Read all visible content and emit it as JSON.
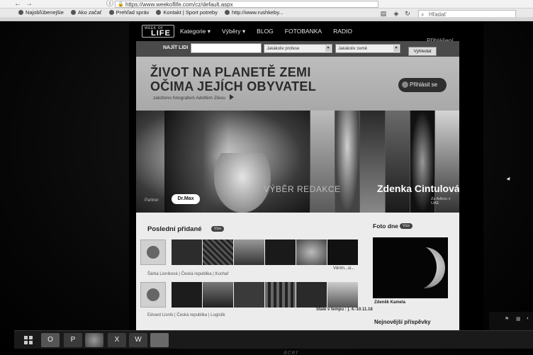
{
  "browser": {
    "url": "https://www.weekoflife.com/cz/default.aspx",
    "search_placeholder": "Hľadať",
    "bookmarks": [
      "Najobľúbenejšie",
      "Ako začať",
      "Prehľad správ",
      "Kontakt | Sport potreby",
      "http://www.rushkeby..."
    ]
  },
  "site": {
    "logo_small": "WEEK OF",
    "logo_big": "LIFE",
    "menu": [
      "Kategorie",
      "Výběry",
      "BLOG",
      "FOTOBANKA",
      "RADIO"
    ],
    "menu_dropdown_marks": [
      "▾",
      "▾",
      "",
      "",
      ""
    ],
    "login_link": "Přihlášení",
    "search": {
      "label": "NAJÍT LIDI",
      "profession": "Jakákoliv profese",
      "country": "Jakákoliv země",
      "button": "Vyhledat"
    },
    "hero": {
      "headline_1": "ŽIVOT NA PLANETĚ ZEMI",
      "headline_2": "OČIMA JEJÍCH OBYVATEL",
      "subline": "založeno fotografem Adolfem Zikou",
      "signin": "Přihlásit se"
    },
    "feature": {
      "partner_label": "Partner",
      "partner": "Dr.Max",
      "section": "VÝBĚR REDAKCE",
      "name": "Zdenka Cintulová",
      "sub": "Za Adkou v UAE"
    },
    "latest": {
      "title": "Poslední přidané",
      "more": "Více",
      "rows": [
        {
          "meta": "Šárka Lisníková  |  Česká republika  |  Kuchař",
          "right": "Věrím...si..."
        },
        {
          "meta": "Edvard Lisník  |  Česká republika  |  Logistik",
          "right": "Stále v tempu : ). 4.-10.11.18"
        }
      ]
    },
    "photo_of_day": {
      "title": "Foto dne",
      "more": "Více",
      "author": "Zdeněk Kamela"
    },
    "next_section": "Nejnovější příspěvky"
  },
  "taskbar": {
    "icons": [
      "windows-start",
      "outlook",
      "powerpoint",
      "firefox",
      "excel",
      "word",
      "files"
    ],
    "labels": [
      "",
      "O",
      "P",
      "",
      "X",
      "W",
      ""
    ],
    "brand": "acer"
  },
  "colors": {
    "background": "#000000",
    "hero_banner": "#b3b3b3",
    "content_bg": "#ececec"
  }
}
